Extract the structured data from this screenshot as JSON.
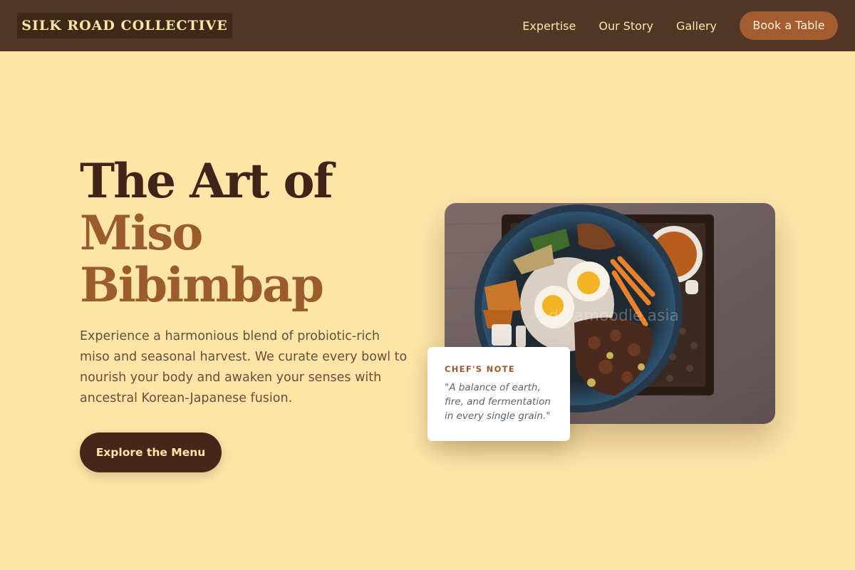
{
  "header": {
    "brand": "SILK ROAD COLLECTIVE",
    "nav": [
      "Expertise",
      "Our Story",
      "Gallery"
    ],
    "cta_label": "Book a Table"
  },
  "hero": {
    "title_line1": "The Art of",
    "title_line2": "Miso",
    "title_line3": "Bibimbap",
    "description": "Experience a harmonious blend of probiotic-rich miso and seasonal harvest. We curate every bowl to nourish your body and awaken your senses with ancestral Korean-Japanese fusion.",
    "button_label": "Explore the Menu"
  },
  "image": {
    "subject": "miso bibimbap bowl photo",
    "watermark": "dreamoodle.asia"
  },
  "note": {
    "label": "CHEF'S NOTE",
    "quote": "\"A balance of earth, fire, and fermentation in every single grain.\""
  },
  "colors": {
    "background": "#fde5a8",
    "header": "#513626",
    "accent": "#a35c2f",
    "title_dark": "#3f2417",
    "title_accent": "#9a5b2f",
    "button_dark": "#452619"
  }
}
